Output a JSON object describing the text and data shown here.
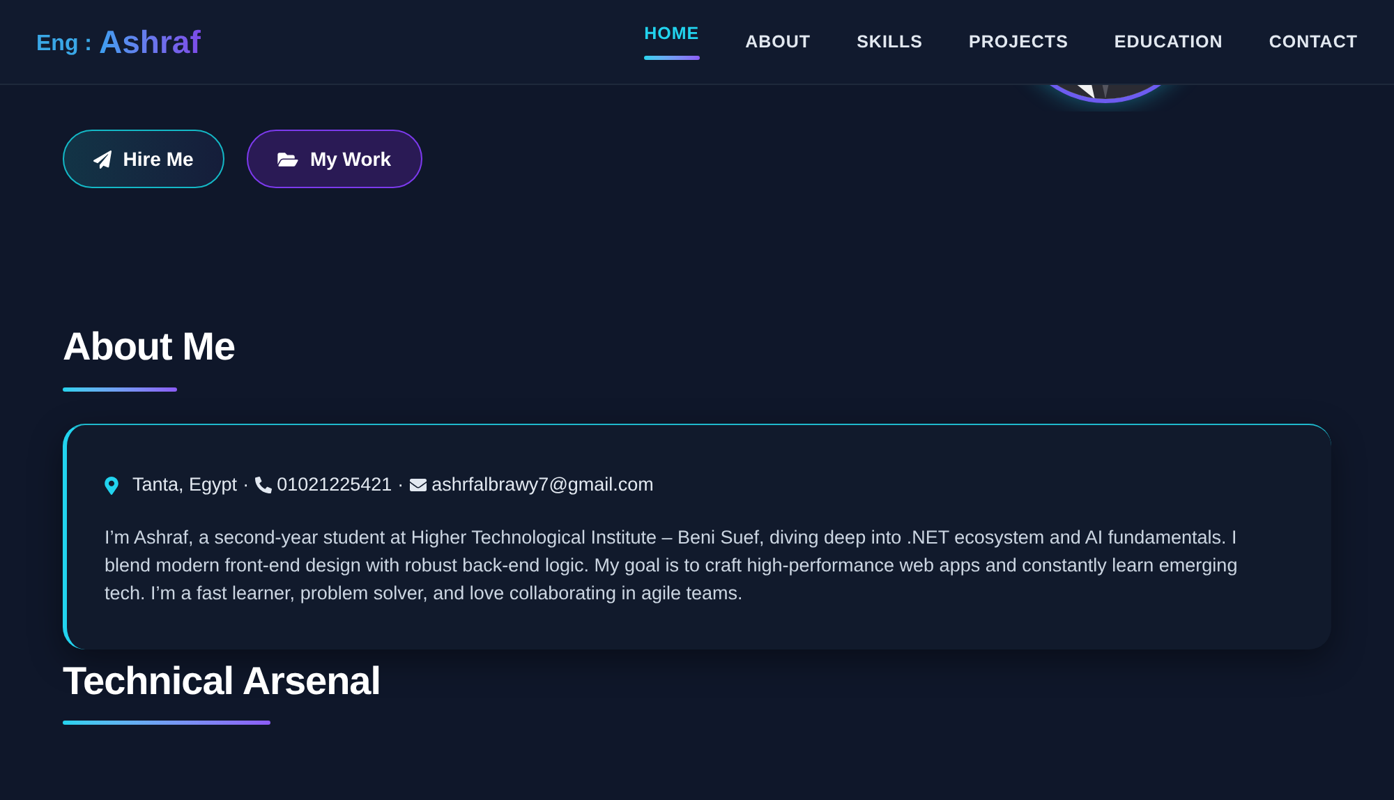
{
  "brand": {
    "prefix": "Eng :",
    "name": "Ashraf"
  },
  "nav": [
    {
      "label": "HOME",
      "selected": true
    },
    {
      "label": "ABOUT",
      "selected": false
    },
    {
      "label": "SKILLS",
      "selected": false
    },
    {
      "label": "PROJECTS",
      "selected": false
    },
    {
      "label": "EDUCATION",
      "selected": false
    },
    {
      "label": "CONTACT",
      "selected": false
    }
  ],
  "hero": {
    "buttons": [
      {
        "label": "Hire Me",
        "kind": "primary"
      },
      {
        "label": "My Work",
        "kind": "secondary"
      }
    ]
  },
  "about": {
    "title": "About Me",
    "contact": {
      "location": "Tanta, Egypt",
      "separator_1": "·",
      "phone": "01021225421",
      "separator_2": "·",
      "email": "ashrfalbrawy7@gmail.com"
    },
    "text": "I’m Ashraf, a second-year student at Higher Technological Institute – Beni Suef, diving deep into .NET ecosystem and AI fundamentals. I blend modern front-end design with robust back-end logic. My goal is to craft high-performance web apps and constantly learn emerging tech. I’m a fast learner, problem solver, and love collaborating in agile teams."
  },
  "skills": {
    "title": "Technical Arsenal"
  }
}
